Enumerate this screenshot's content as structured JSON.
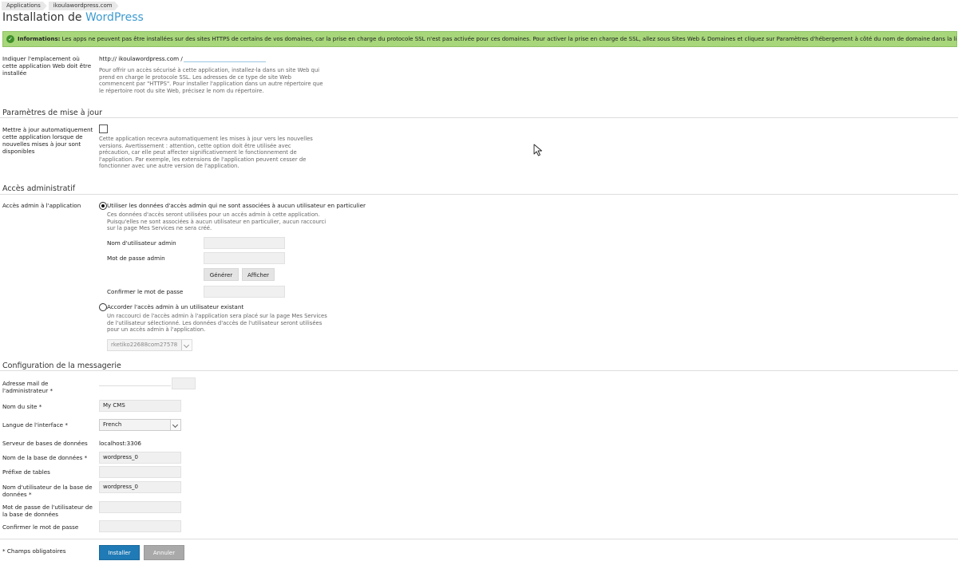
{
  "breadcrumb": [
    "Applications",
    "ikoulawordpress.com"
  ],
  "page_title": {
    "prefix": "Installation de ",
    "brand": "WordPress"
  },
  "info": {
    "label": "Informations:",
    "text": " Les apps ne peuvent pas être installées sur des sites HTTPS de certains de vos domaines, car la prise en charge du protocole SSL n'est pas activée pour ces domaines. Pour activer la prise en charge de SSL, allez sous Sites Web & Domaines et cliquez sur Paramètres d'hébergement à côté du nom de domaine dans la liste."
  },
  "location": {
    "label": "Indiquer l'emplacement où cette application Web doit être installée",
    "url_prefix": "http:// ikoulawordpress.com /",
    "help": "Pour offrir un accès sécurisé à cette application, installez-la dans un site Web qui prend en charge le protocole SSL. Les adresses de ce type de site Web commencent par \"HTTPS\". Pour installer l'application dans un autre répertoire que le répertoire root du site Web, précisez le nom du répertoire."
  },
  "updates": {
    "title": "Paramètres de mise à jour",
    "label": "Mettre à jour automatiquement cette application lorsque de nouvelles mises à jour sont disponibles",
    "checked": false,
    "help": "Cette application recevra automatiquement les mises à jour vers les nouvelles versions. Avertissement : attention, cette option doit être utilisée avec précaution, car elle peut affecter significativement le fonctionnement de l'application. Par exemple, les extensions de l'application peuvent cesser de fonctionner avec une autre version de l'application."
  },
  "admin": {
    "title": "Accès administratif",
    "label": "Accès admin à l'application",
    "option1": "Utiliser les données d'accès admin qui ne sont associées à aucun utilisateur en particulier",
    "option1_help": "Ces données d'accès seront utilisées pour un accès admin à cette application. Puisqu'elles ne sont associées à aucun utilisateur en particulier, aucun raccourci sur la page Mes Services ne sera créé.",
    "username_label": "Nom d'utilisateur admin",
    "password_label": "Mot de passe admin",
    "generate_btn": "Générer",
    "show_btn": "Afficher",
    "confirm_label": "Confirmer le mot de passe",
    "option2": "Accorder l'accès admin à un utilisateur existant",
    "option2_help": "Un raccourci de l'accès admin à l'application sera placé sur la page Mes Services de l'utilisateur sélectionné. Les données d'accès de l'utilisateur seront utilisées pour un accès admin à l'application.",
    "user_select": "rketiko22688com27578"
  },
  "mail": {
    "title": "Configuration de la messagerie",
    "admin_email_label": "Adresse mail de l'administrateur *",
    "site_name_label": "Nom du site *",
    "site_name_value": "My CMS",
    "language_label": "Langue de l'interface *",
    "language_value": "French",
    "db_server_label": "Serveur de bases de données",
    "db_server_value": "localhost:3306",
    "db_name_label": "Nom de la base de données *",
    "db_name_value": "wordpress_0",
    "prefix_label": "Préfixe de tables",
    "db_user_label": "Nom d'utilisateur de la base de données *",
    "db_user_value": "wordpress_0",
    "db_pass_label": "Mot de passe de l'utilisateur de la base de données",
    "db_confirm_label": "Confirmer le mot de passe"
  },
  "footer": {
    "required_note": "* Champs obligatoires",
    "install_btn": "Installer",
    "cancel_btn": "Annuler"
  }
}
